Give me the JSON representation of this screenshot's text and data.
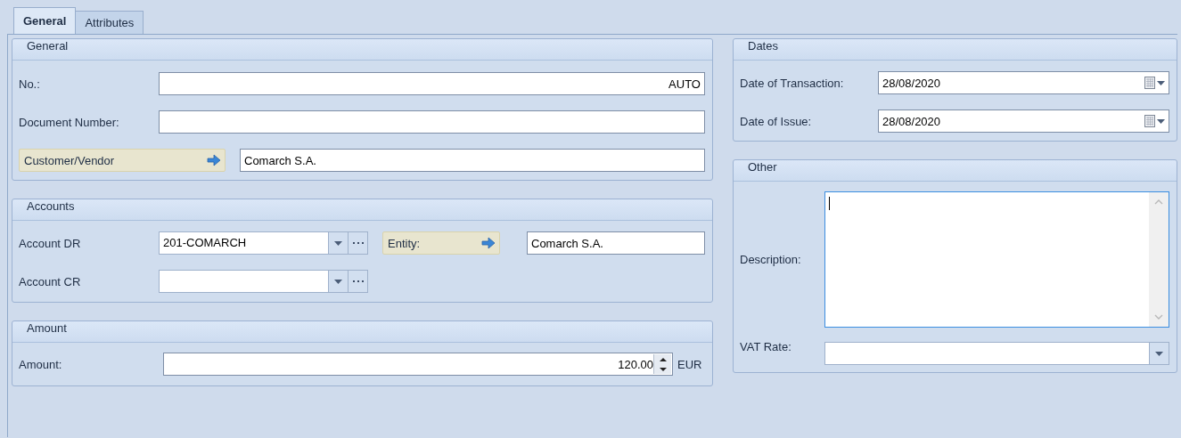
{
  "tabs": [
    {
      "label": "General",
      "selected": true
    },
    {
      "label": "Attributes",
      "selected": false
    }
  ],
  "general": {
    "title": "General",
    "number": {
      "label": "No.:",
      "value": "AUTO"
    },
    "document_number": {
      "label": "Document Number:"
    },
    "customer": {
      "label": "Customer/Vendor",
      "value": "Comarch S.A."
    }
  },
  "accounts": {
    "title": "Accounts",
    "rows": [
      {
        "label": "Account DR",
        "value": "201-COMARCH"
      },
      {
        "label": "Account CR"
      }
    ],
    "entity": {
      "label": "Entity:",
      "value": "Comarch S.A."
    }
  },
  "amount": {
    "title": "Amount",
    "label": "Amount:",
    "value": "120.00",
    "currency": "EUR"
  },
  "dates": {
    "title": "Dates",
    "fields": [
      {
        "label": "Date of Transaction:",
        "value": "28/08/2020"
      },
      {
        "label": "Date of Issue:",
        "value": "28/08/2020"
      }
    ]
  },
  "other": {
    "title": "Other",
    "description": {
      "label": "Description:",
      "focused": true
    },
    "vat_rate": {
      "label": "VAT Rate:"
    }
  }
}
